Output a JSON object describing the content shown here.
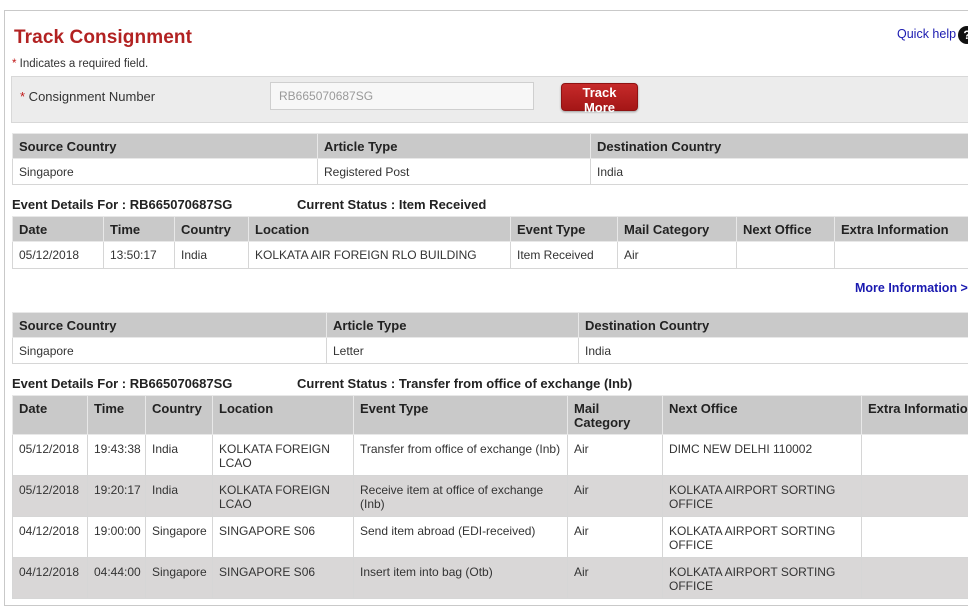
{
  "page": {
    "title": "Track Consignment",
    "quick_help": "Quick help",
    "help_glyph": "?",
    "required_star": "*",
    "required_note": " Indicates a required field."
  },
  "form": {
    "star": "*",
    "label": " Consignment Number",
    "value": "RB665070687SG",
    "button": "Track More"
  },
  "colors": {
    "brand_red": "#b22222",
    "link_blue": "#1a1ab0",
    "header_gray": "#c9c9c9",
    "row_shade": "#d9d7d7"
  },
  "shipment1": {
    "headers": [
      "Source Country",
      "Article Type",
      "Destination Country"
    ],
    "row": [
      "Singapore",
      "Registered Post",
      "India"
    ],
    "event_for_label": "Event Details For : RB665070687SG",
    "status_label": "Current Status : Item Received",
    "event_headers": [
      "Date",
      "Time",
      "Country",
      "Location",
      "Event Type",
      "Mail Category",
      "Next Office",
      "Extra Information"
    ],
    "events": [
      [
        "05/12/2018",
        "13:50:17",
        "India",
        "KOLKATA AIR FOREIGN RLO BUILDING",
        "Item Received",
        "Air",
        "",
        ""
      ]
    ],
    "more_info": "More Information >"
  },
  "shipment2": {
    "headers": [
      "Source Country",
      "Article Type",
      "Destination Country"
    ],
    "row": [
      "Singapore",
      "Letter",
      "India"
    ],
    "event_for_label": "Event Details For : RB665070687SG",
    "status_label": "Current Status : Transfer from office of exchange (Inb)",
    "event_headers": [
      "Date",
      "Time",
      "Country",
      "Location",
      "Event Type",
      "Mail Category",
      "Next Office",
      "Extra Information"
    ],
    "events": [
      [
        "05/12/2018",
        "19:43:38",
        "India",
        "KOLKATA FOREIGN LCAO",
        "Transfer from office of exchange (Inb)",
        "Air",
        "DIMC NEW DELHI 110002",
        ""
      ],
      [
        "05/12/2018",
        "19:20:17",
        "India",
        "KOLKATA FOREIGN LCAO",
        "Receive item at office of exchange (Inb)",
        "Air",
        "KOLKATA AIRPORT SORTING OFFICE",
        ""
      ],
      [
        "04/12/2018",
        "19:00:00",
        "Singapore",
        "SINGAPORE S06",
        "Send item abroad (EDI-received)",
        "Air",
        "KOLKATA AIRPORT SORTING OFFICE",
        ""
      ],
      [
        "04/12/2018",
        "04:44:00",
        "Singapore",
        "SINGAPORE S06",
        "Insert item into bag (Otb)",
        "Air",
        "KOLKATA AIRPORT SORTING OFFICE",
        ""
      ]
    ]
  }
}
